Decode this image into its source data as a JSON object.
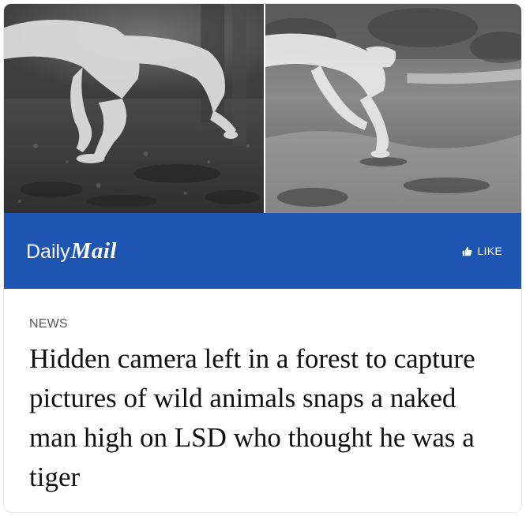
{
  "post": {
    "photos": [
      {
        "name": "trail-cam-photo-left",
        "icon": "crawling-man-photo"
      },
      {
        "name": "trail-cam-photo-right",
        "icon": "crawling-man-photo"
      }
    ],
    "brand": {
      "daily": "Daily",
      "mail": "Mail",
      "background_color": "#1f55b2",
      "text_color": "#ffffff"
    },
    "like": {
      "label": "LIKE",
      "icon": "thumbs-up-icon"
    },
    "article": {
      "section": "NEWS",
      "headline": "Hidden camera left in a forest to capture pictures of wild animals snaps a naked man high on LSD who thought he was a tiger"
    }
  }
}
